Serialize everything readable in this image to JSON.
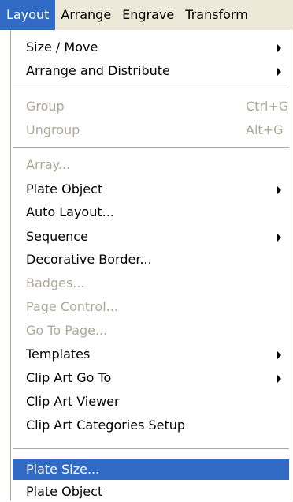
{
  "menubar": {
    "items": [
      {
        "label": "Layout",
        "active": true
      },
      {
        "label": "Arrange",
        "active": false
      },
      {
        "label": "Engrave",
        "active": false
      },
      {
        "label": "Transform",
        "active": false
      }
    ]
  },
  "menu": {
    "items": [
      {
        "label": "Size / Move",
        "submenu": true,
        "disabled": false
      },
      {
        "label": "Arrange and Distribute",
        "submenu": true,
        "disabled": false
      },
      {
        "label": "Group",
        "shortcut": "Ctrl+G",
        "disabled": true
      },
      {
        "label": "Ungroup",
        "shortcut": "Alt+G",
        "disabled": true
      },
      {
        "label": "Array...",
        "disabled": true
      },
      {
        "label": "Plate Object",
        "submenu": true,
        "disabled": false
      },
      {
        "label": "Auto Layout...",
        "disabled": false
      },
      {
        "label": "Sequence",
        "submenu": true,
        "disabled": false
      },
      {
        "label": "Decorative Border...",
        "disabled": false
      },
      {
        "label": "Badges...",
        "disabled": true
      },
      {
        "label": "Page Control...",
        "disabled": true
      },
      {
        "label": "Go To Page...",
        "disabled": true
      },
      {
        "label": "Templates",
        "submenu": true,
        "disabled": false
      },
      {
        "label": "Clip Art Go To",
        "submenu": true,
        "disabled": false
      },
      {
        "label": "Clip Art Viewer",
        "disabled": false
      },
      {
        "label": "Clip Art Categories Setup",
        "disabled": false
      },
      {
        "label": "Plate Size...",
        "disabled": false,
        "highlighted": true
      },
      {
        "label": "Plate Object",
        "disabled": false
      }
    ]
  },
  "colors": {
    "highlight": "#316ac5",
    "disabled_text": "#aca899",
    "menubar_bg": "#ece9d8"
  }
}
